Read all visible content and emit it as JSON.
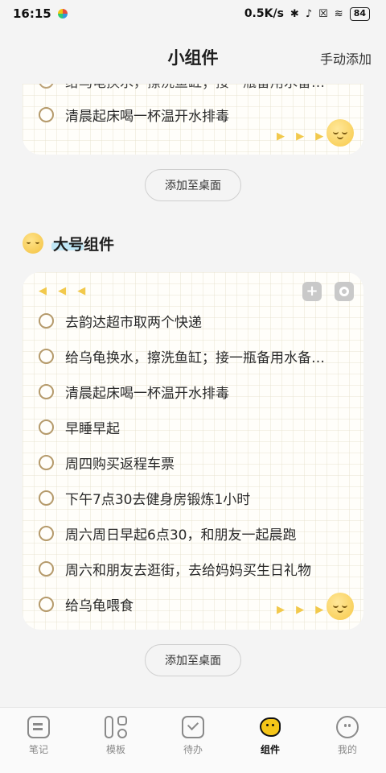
{
  "status_bar": {
    "time": "16:15",
    "network_speed": "0.5K/s",
    "battery": "84"
  },
  "header": {
    "title": "小组件",
    "action": "手动添加"
  },
  "top_widget": {
    "items": [
      {
        "text": "给乌龟换水，擦洗鱼缸；接一瓶备用水备…"
      },
      {
        "text": "清晨起床喝一杯温开水排毒"
      }
    ],
    "arrows": "▶ ▶ ▶"
  },
  "add_button_label": "添加至桌面",
  "section": {
    "title": "大号组件"
  },
  "large_widget": {
    "arrows_left": "◀ ◀ ◀",
    "arrows_right": "▶ ▶ ▶",
    "add_icon": "+",
    "items": [
      {
        "text": "去韵达超市取两个快递"
      },
      {
        "text": "给乌龟换水，擦洗鱼缸；接一瓶备用水备…"
      },
      {
        "text": "清晨起床喝一杯温开水排毒"
      },
      {
        "text": "早睡早起"
      },
      {
        "text": "周四购买返程车票"
      },
      {
        "text": "下午7点30去健身房锻炼1小时"
      },
      {
        "text": "周六周日早起6点30，和朋友一起晨跑"
      },
      {
        "text": "周六和朋友去逛街，去给妈妈买生日礼物"
      },
      {
        "text": "给乌龟喂食"
      }
    ]
  },
  "bottom_nav": [
    {
      "label": "笔记",
      "icon": "note-icon",
      "active": false
    },
    {
      "label": "模板",
      "icon": "template-icon",
      "active": false
    },
    {
      "label": "待办",
      "icon": "todo-icon",
      "active": false
    },
    {
      "label": "组件",
      "icon": "widget-icon",
      "active": true
    },
    {
      "label": "我的",
      "icon": "profile-icon",
      "active": false
    }
  ],
  "colors": {
    "accent_yellow": "#f5c518",
    "checkbox_border": "#b59a6b",
    "highlight_blue": "#bfe6f5"
  }
}
